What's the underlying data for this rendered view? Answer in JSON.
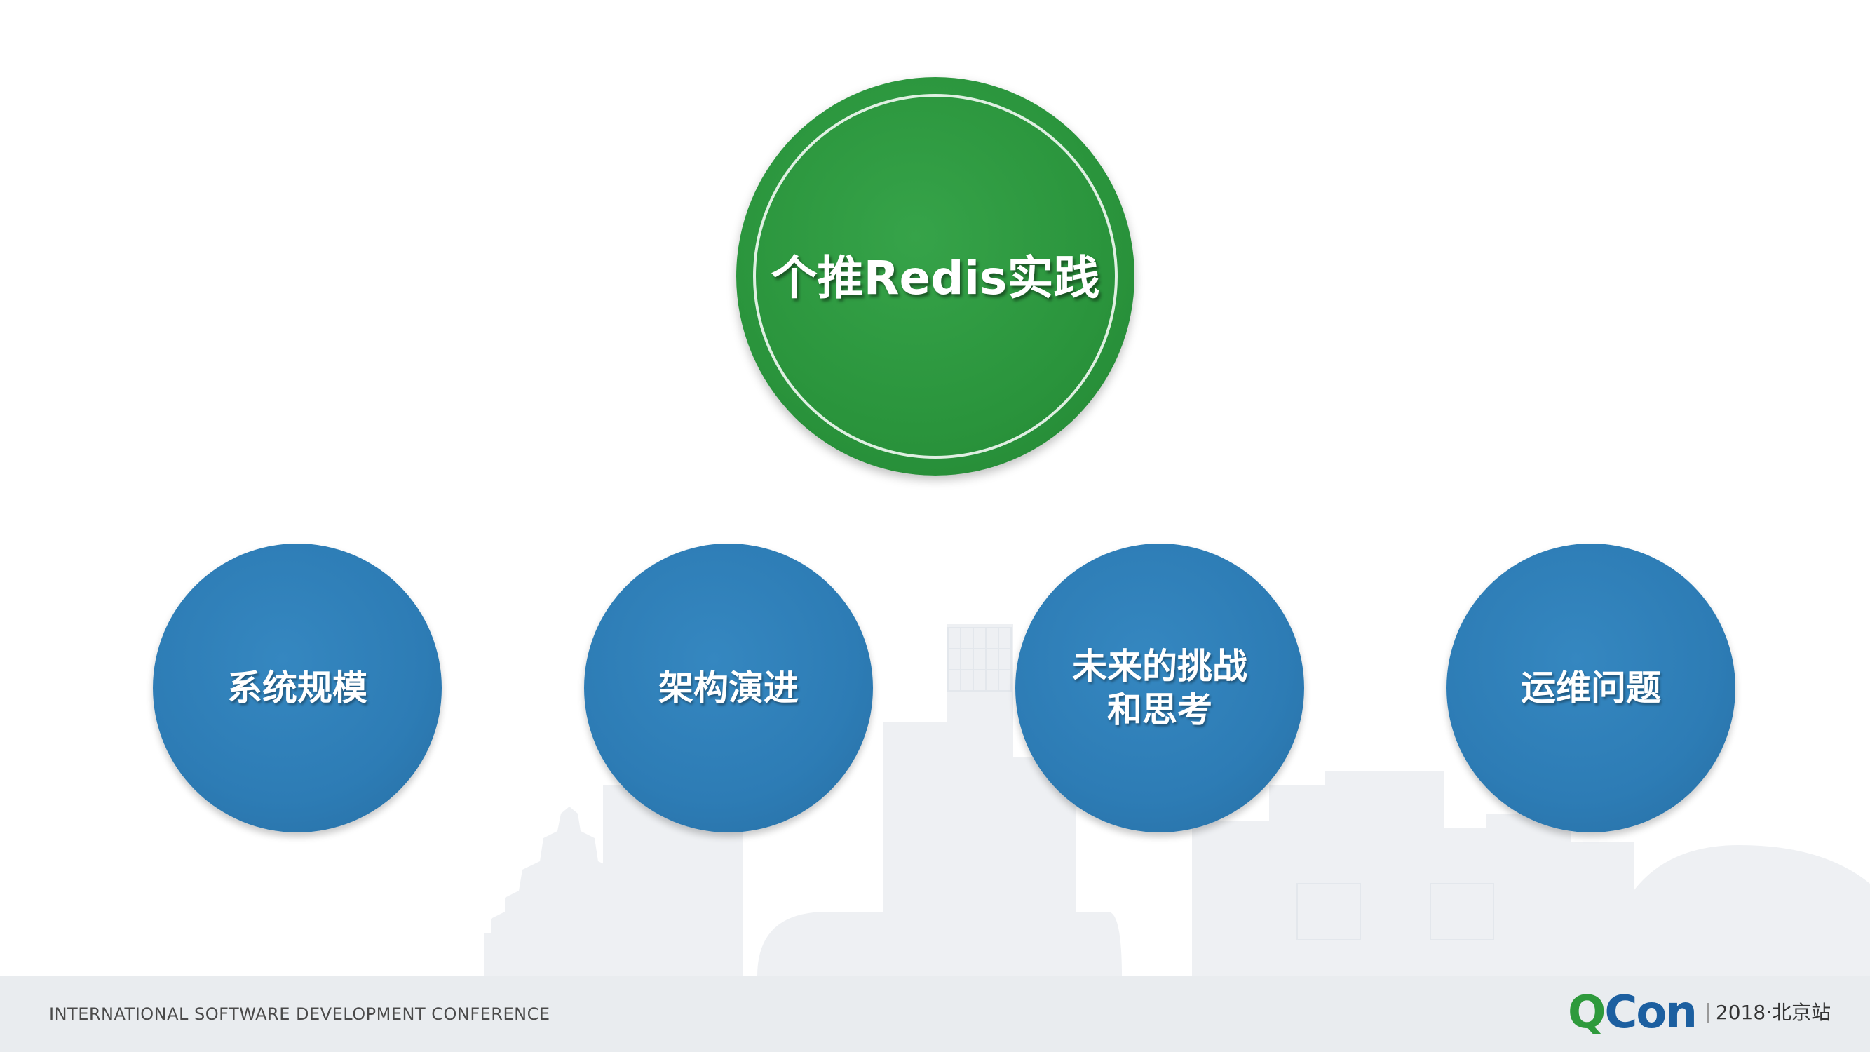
{
  "slide": {
    "title": "个推Redis实践",
    "topics": [
      {
        "label": "系统规模"
      },
      {
        "label": "架构演进"
      },
      {
        "label": "未来的挑战\n和思考"
      },
      {
        "label": "运维问题"
      }
    ]
  },
  "footer": {
    "conference_text": "INTERNATIONAL SOFTWARE DEVELOPMENT CONFERENCE",
    "logo_q": "Q",
    "logo_con": "Con",
    "logo_edition": "2018·北京站"
  },
  "colors": {
    "main_circle": "#2a943c",
    "topic_circle": "#2d7cb5",
    "footer_bg": "#e9ecef",
    "logo_green": "#2e9a3c",
    "logo_blue": "#1c5fa0"
  }
}
